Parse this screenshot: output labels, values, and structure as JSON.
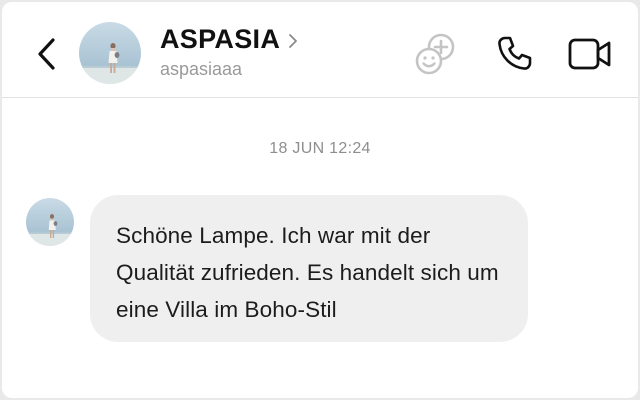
{
  "header": {
    "contact_name": "ASPASIA",
    "contact_handle": "aspasiaaa",
    "icons": {
      "back": "chevron-left-icon",
      "profile": "chevron-right-icon",
      "add_people": "add-people-icon",
      "call": "phone-icon",
      "video": "video-camera-icon"
    }
  },
  "thread": {
    "timestamp": "18 JUN 12:24",
    "messages": [
      {
        "sender": "ASPASIA",
        "text": "Schöne Lampe. Ich war mit der Qualität zufrieden. Es handelt sich um eine Villa im Boho-Stil"
      }
    ]
  },
  "colors": {
    "bubble_bg": "#efefef",
    "divider": "#e3e3e3",
    "muted_text": "#8e8e8e",
    "icon_gray": "#c4c4c4",
    "text": "#111111"
  }
}
